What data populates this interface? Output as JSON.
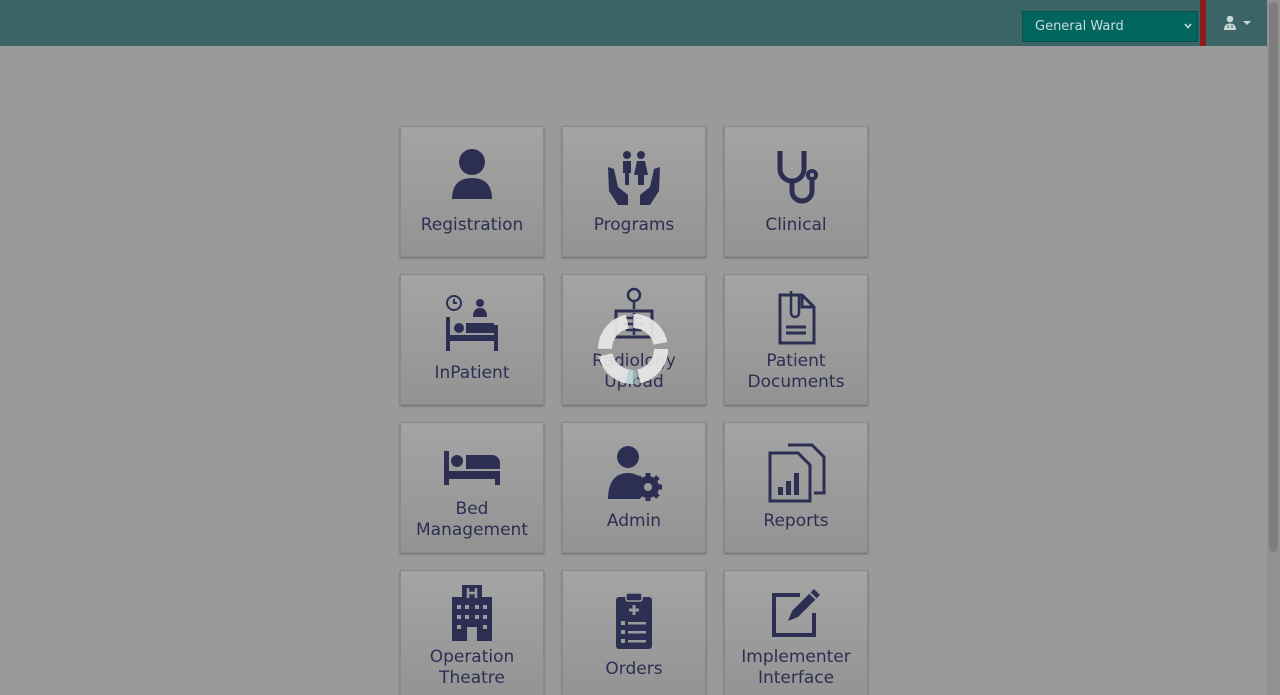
{
  "header": {
    "location_select": {
      "value": "General Ward"
    },
    "user_menu": {
      "icon": "user-doctor-icon"
    }
  },
  "tiles": [
    {
      "label": "Registration",
      "icon": "user-icon"
    },
    {
      "label": "Programs",
      "icon": "family-hands-icon"
    },
    {
      "label": "Clinical",
      "icon": "stethoscope-icon"
    },
    {
      "label": "InPatient",
      "icon": "inpatient-bed-icon"
    },
    {
      "label": "Radiology\nUpload",
      "icon": "xray-icon"
    },
    {
      "label": "Patient\nDocuments",
      "icon": "paperclip-document-icon"
    },
    {
      "label": "Bed\nManagement",
      "icon": "bed-icon"
    },
    {
      "label": "Admin",
      "icon": "user-gear-icon"
    },
    {
      "label": "Reports",
      "icon": "report-chart-icon"
    },
    {
      "label": "Operation\nTheatre",
      "icon": "hospital-icon"
    },
    {
      "label": "Orders",
      "icon": "clipboard-list-icon"
    },
    {
      "label": "Implementer\nInterface",
      "icon": "edit-icon"
    }
  ],
  "colors": {
    "header_bg": "#3a6465",
    "select_bg": "#02665f",
    "tile_text": "#2c2f52",
    "overlay_bg": "#9a9a9a",
    "accent_red": "#8f1b1f"
  },
  "loading": {
    "icon": "loading-spinner-icon"
  }
}
